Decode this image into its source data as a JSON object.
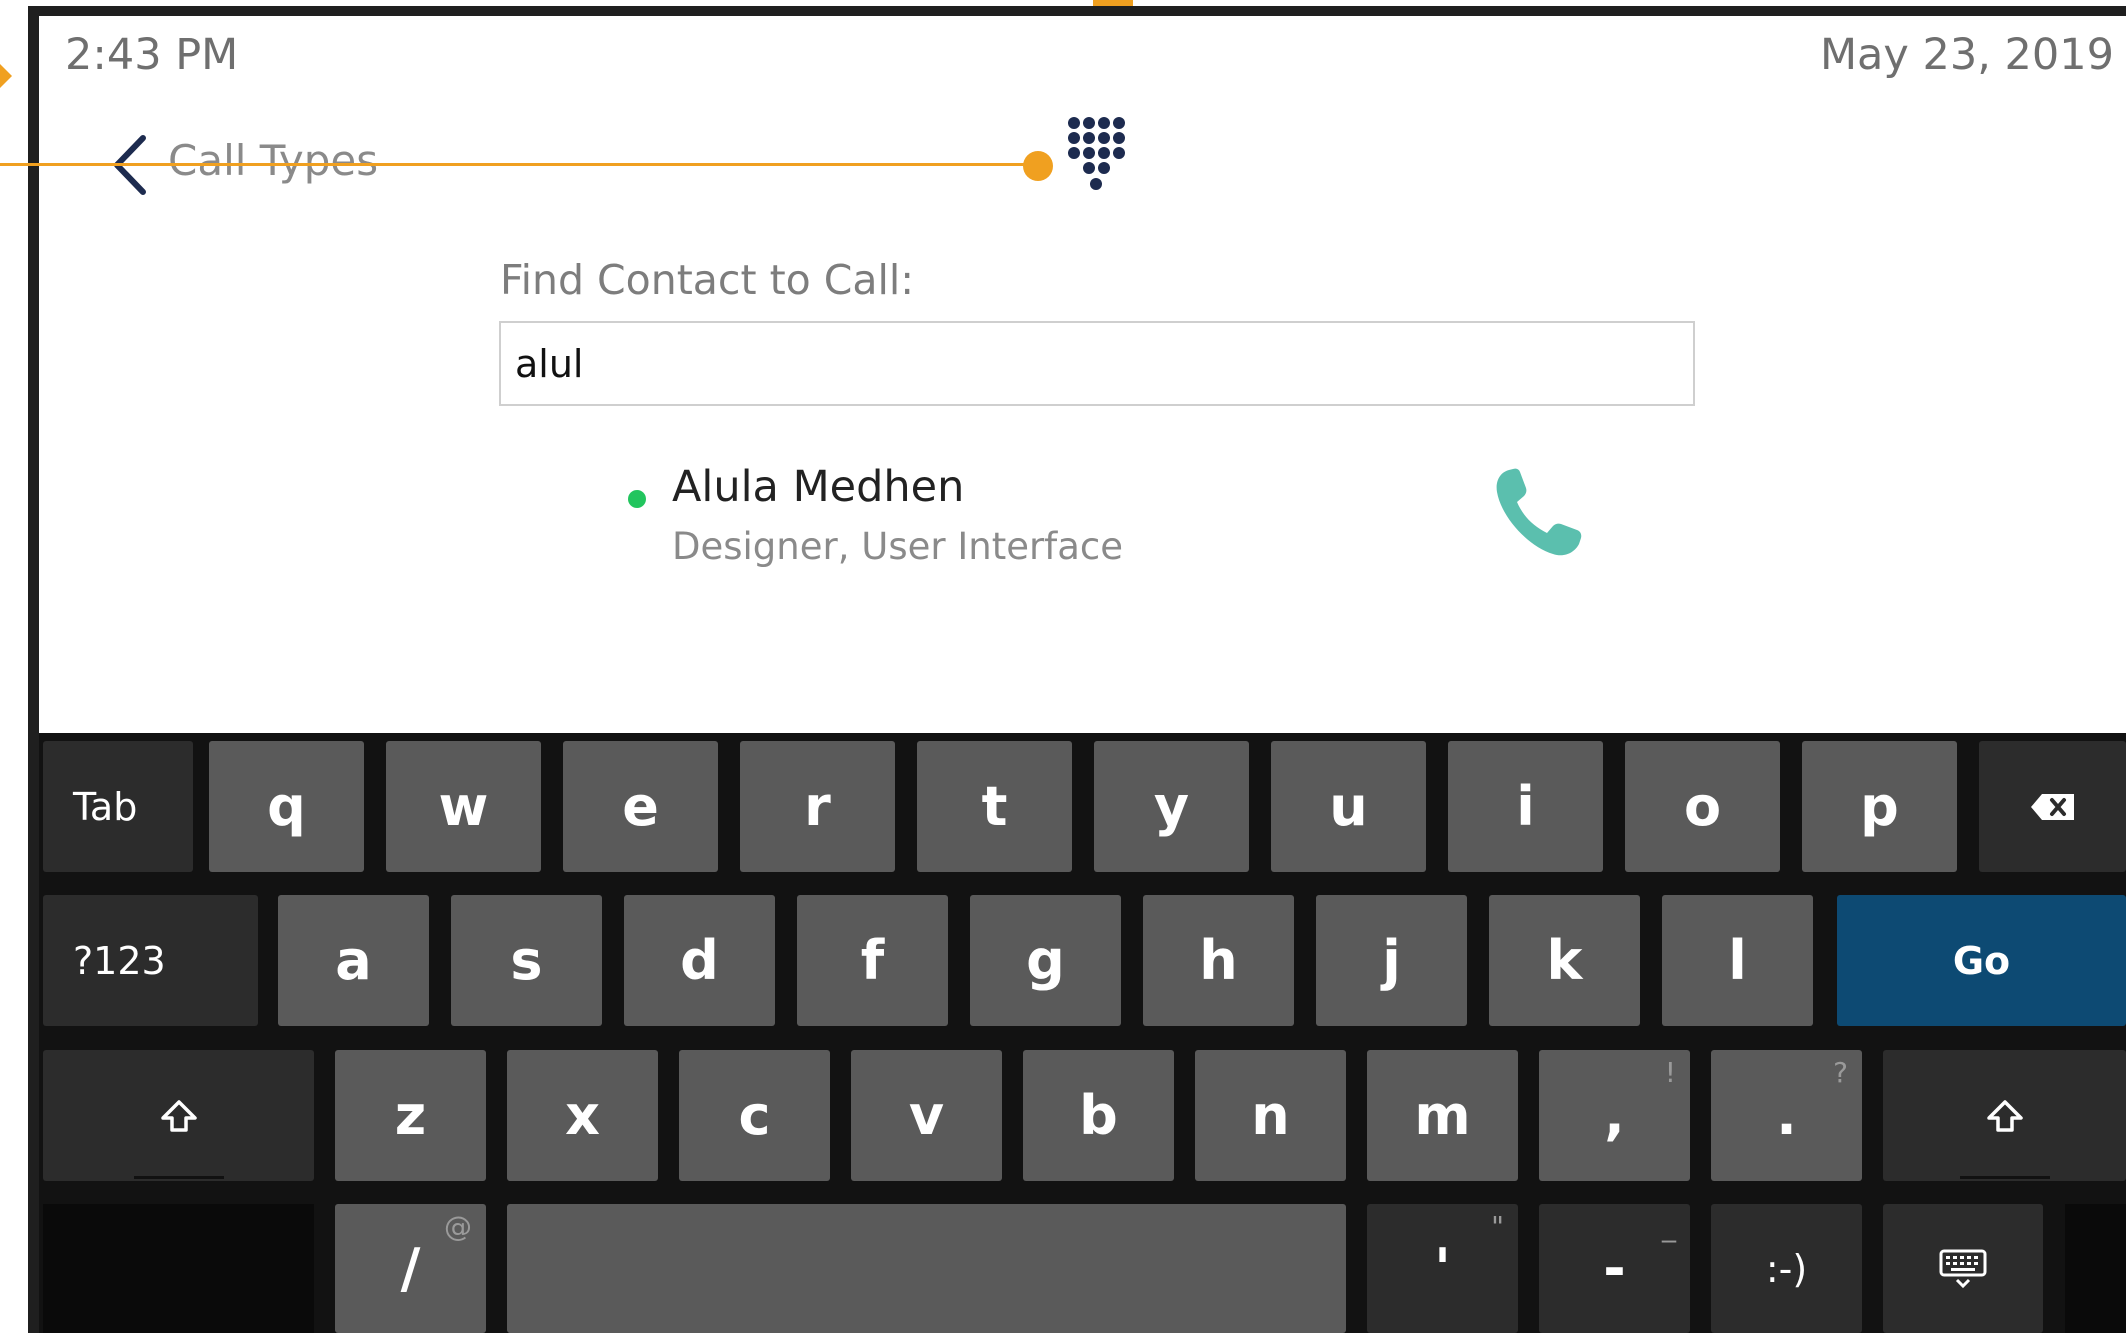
{
  "status_bar": {
    "time": "2:43 PM",
    "date": "May 23, 2019"
  },
  "header": {
    "back_label": "Call Types",
    "back_icon": "chevron-left-icon",
    "dialpad_icon": "dialpad-icon"
  },
  "search": {
    "label": "Find Contact to Call:",
    "value": "alul"
  },
  "results": [
    {
      "name": "Alula Medhen",
      "title": "Designer, User Interface",
      "presence_color": "#22c55e",
      "action_icon": "phone-icon"
    }
  ],
  "keyboard": {
    "row1": [
      "q",
      "w",
      "e",
      "r",
      "t",
      "y",
      "u",
      "i",
      "o",
      "p"
    ],
    "row2": [
      "a",
      "s",
      "d",
      "f",
      "g",
      "h",
      "j",
      "k",
      "l"
    ],
    "row3": [
      "z",
      "x",
      "c",
      "v",
      "b",
      "n",
      "m",
      ",",
      "."
    ],
    "row3_alts": {
      ",": "!",
      ".": "?"
    },
    "tab_label": "Tab",
    "sym_label": "?123",
    "go_label": "Go",
    "slash_label": "/",
    "slash_alt": "@",
    "apostrophe_label": "'",
    "apostrophe_alt": "\"",
    "dash_label": "-",
    "dash_alt": "_",
    "smiley_label": ":-)"
  },
  "colors": {
    "accent_annotation": "#f0a020",
    "go_key": "#0d4a73",
    "phone_icon": "#5bbfae",
    "presence": "#22c55e"
  }
}
